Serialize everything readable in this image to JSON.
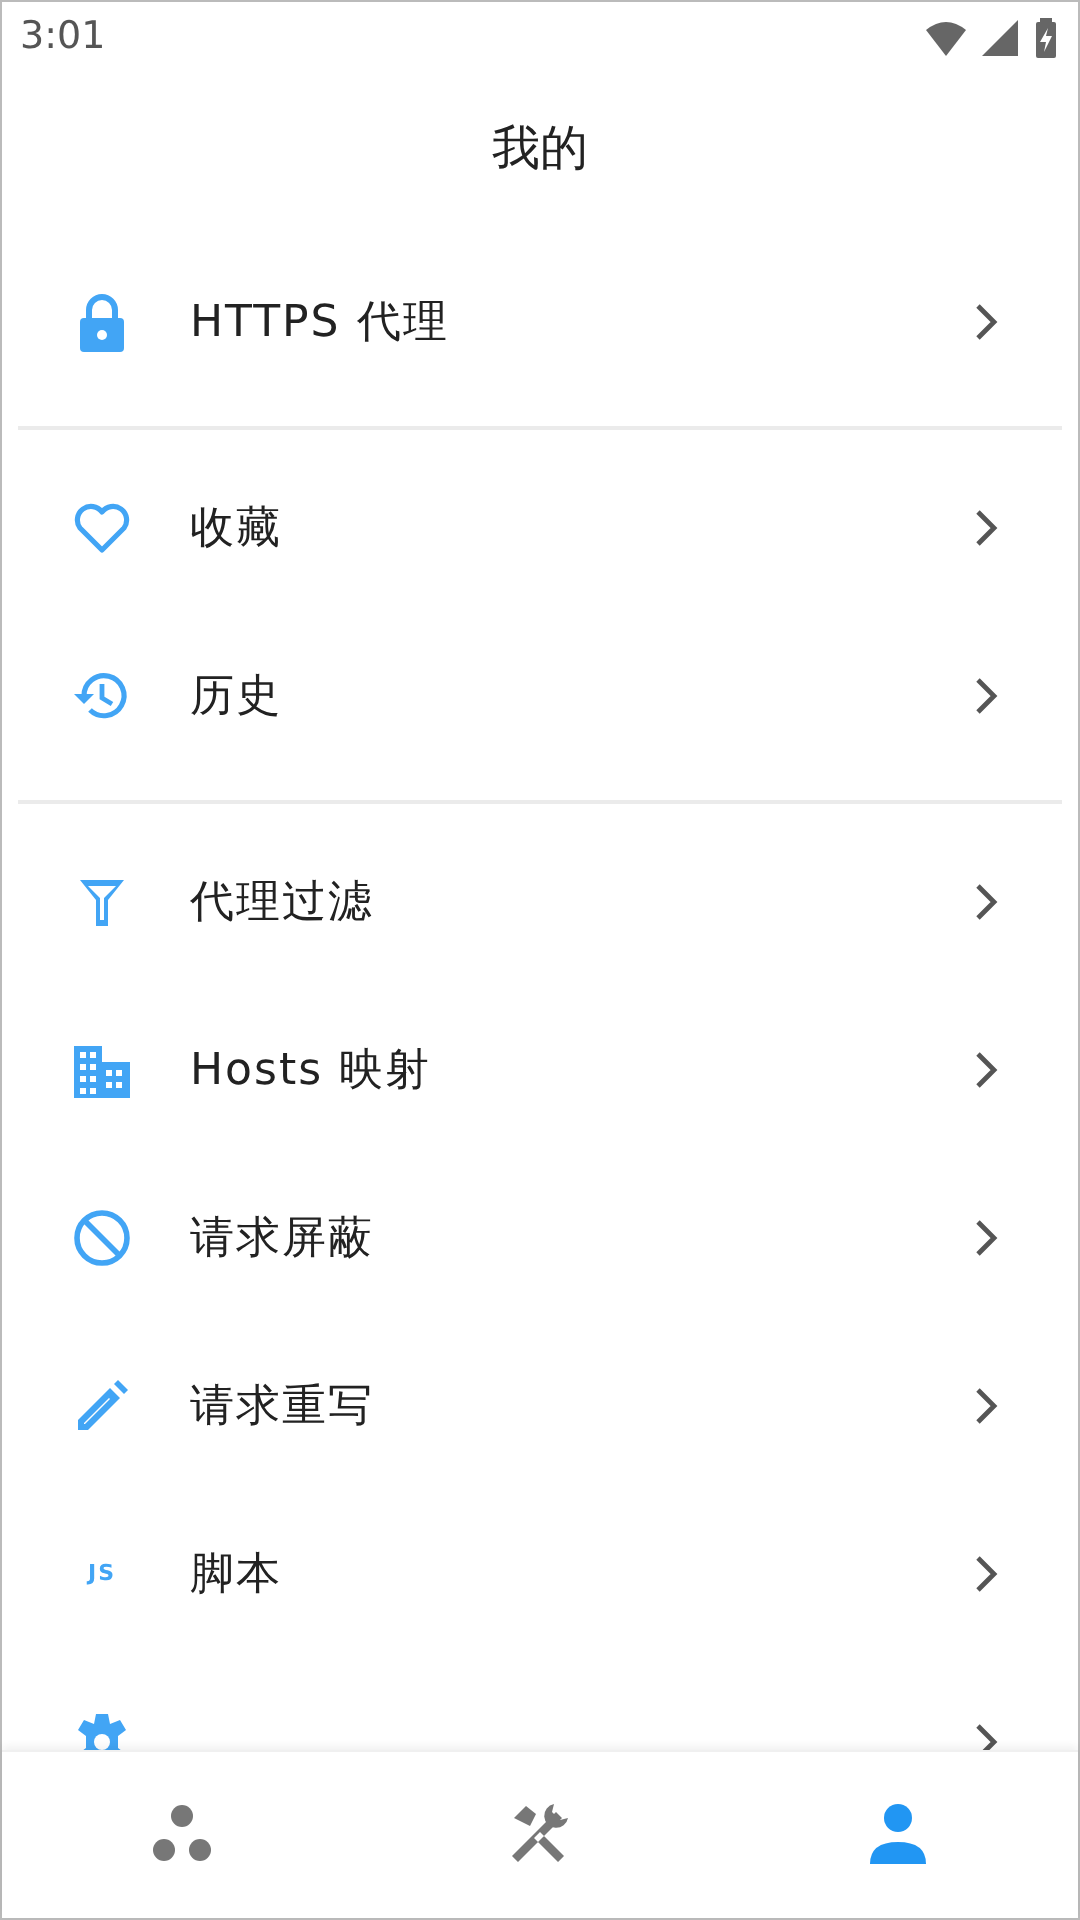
{
  "status_bar": {
    "time": "3:01"
  },
  "title": "我的",
  "sections": [
    {
      "items": [
        {
          "kind": "lock",
          "label": "HTTPS 代理"
        }
      ]
    },
    {
      "items": [
        {
          "kind": "heart",
          "label": "收藏"
        },
        {
          "kind": "history",
          "label": "历史"
        }
      ]
    },
    {
      "items": [
        {
          "kind": "filter",
          "label": "代理过滤"
        },
        {
          "kind": "building",
          "label": "Hosts 映射"
        },
        {
          "kind": "block",
          "label": "请求屏蔽"
        },
        {
          "kind": "pencil",
          "label": "请求重写"
        },
        {
          "kind": "text",
          "icon_text": "JS",
          "label": "脚本"
        },
        {
          "kind": "gear"
        }
      ]
    }
  ],
  "bottom_nav": [
    {
      "kind": "dots",
      "selected": false
    },
    {
      "kind": "tools",
      "selected": false
    },
    {
      "kind": "person",
      "selected": true
    }
  ]
}
